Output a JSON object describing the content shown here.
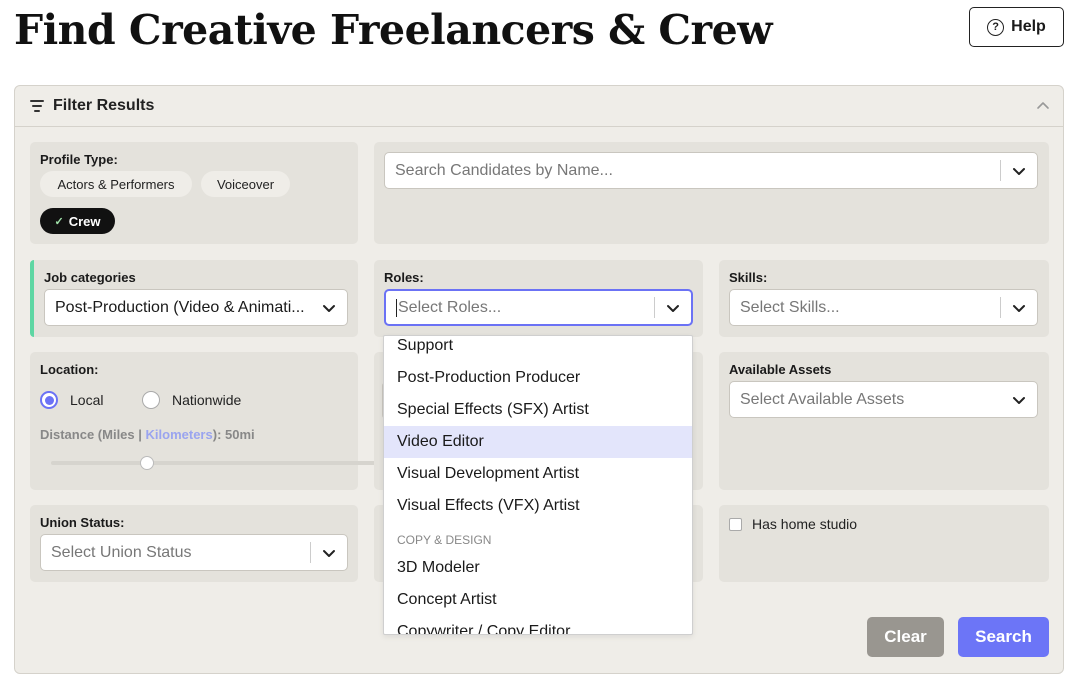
{
  "page": {
    "title": "Find Creative Freelancers & Crew"
  },
  "help": {
    "label": "Help"
  },
  "filter": {
    "title": "Filter Results",
    "profile_type": {
      "label": "Profile Type:",
      "chips": [
        {
          "label": "Actors & Performers",
          "selected": false
        },
        {
          "label": "Voiceover",
          "selected": false
        },
        {
          "label": "Crew",
          "selected": true
        }
      ]
    },
    "name_search": {
      "placeholder": "Search Candidates by Name..."
    },
    "job_categories": {
      "label": "Job categories",
      "value": "Post-Production (Video & Animati..."
    },
    "roles": {
      "label": "Roles:",
      "placeholder": "Select Roles...",
      "options_visible": [
        {
          "type": "item",
          "label": "Support"
        },
        {
          "type": "item",
          "label": "Post-Production Producer"
        },
        {
          "type": "item",
          "label": "Special Effects (SFX) Artist"
        },
        {
          "type": "item",
          "label": "Video Editor",
          "highlighted": true
        },
        {
          "type": "item",
          "label": "Visual Development Artist"
        },
        {
          "type": "item",
          "label": "Visual Effects (VFX) Artist"
        },
        {
          "type": "group",
          "label": "Copy & Design"
        },
        {
          "type": "item",
          "label": "3D Modeler"
        },
        {
          "type": "item",
          "label": "Concept Artist"
        },
        {
          "type": "item",
          "label": "Copywriter / Copy Editor"
        }
      ]
    },
    "skills": {
      "label": "Skills:",
      "placeholder": "Select Skills..."
    },
    "location": {
      "label": "Location:",
      "options": [
        {
          "label": "Local",
          "selected": true
        },
        {
          "label": "Nationwide",
          "selected": false
        }
      ],
      "distance": {
        "prefix": "Distance (Miles ",
        "pipe": "|",
        "alt_unit": "Kilometers",
        "suffix": "): ",
        "value": "50mi"
      },
      "slider_value_miles": 50
    },
    "available_assets": {
      "label": "Available Assets",
      "placeholder": "Select Available Assets"
    },
    "union_status": {
      "label": "Union Status:",
      "placeholder": "Select Union Status"
    },
    "home_studio": {
      "label": "Has home studio",
      "checked": false
    },
    "buttons": {
      "clear": "Clear",
      "search": "Search"
    }
  },
  "colors": {
    "accent": "#6c75f7",
    "category_accent": "#5ed6a3",
    "panel_bg": "#efede8",
    "card_bg": "#e4e2dc",
    "clear_btn": "#999690"
  }
}
